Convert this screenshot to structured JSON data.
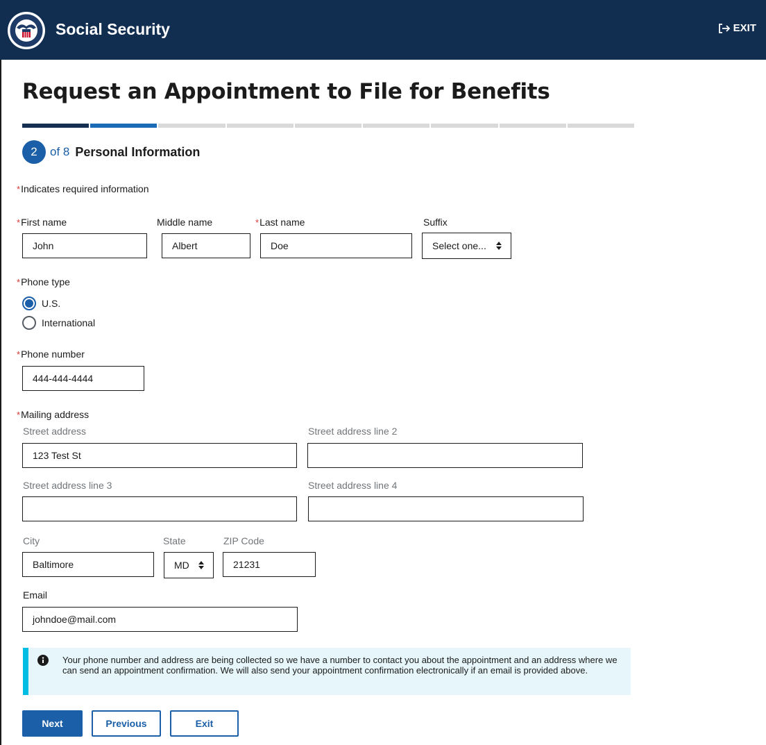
{
  "header": {
    "brand": "Social Security",
    "exit_label": "EXIT"
  },
  "page": {
    "title": "Request an Appointment to File for Benefits"
  },
  "progress": {
    "current_step": 2,
    "total_steps": 8,
    "step_label": "of 8",
    "step_name": "Personal Information"
  },
  "form": {
    "required_note": "Indicates required information",
    "required_marker": "*",
    "first_name": {
      "label": "First name",
      "value": "John"
    },
    "middle_name": {
      "label": "Middle name",
      "value": "Albert"
    },
    "last_name": {
      "label": "Last name",
      "value": "Doe"
    },
    "suffix": {
      "label": "Suffix",
      "selected": "Select one..."
    },
    "phone_type": {
      "label": "Phone type",
      "options": [
        "U.S.",
        "International"
      ],
      "selected": "U.S."
    },
    "phone_number": {
      "label": "Phone number",
      "value": "444-444-4444"
    },
    "mailing_address": {
      "label": "Mailing address",
      "street1": {
        "label": "Street address",
        "value": "123 Test St"
      },
      "street2": {
        "label": "Street address line 2",
        "value": ""
      },
      "street3": {
        "label": "Street address line 3",
        "value": ""
      },
      "street4": {
        "label": "Street address line 4",
        "value": ""
      },
      "city": {
        "label": "City",
        "value": "Baltimore"
      },
      "state": {
        "label": "State",
        "selected": "MD"
      },
      "zip": {
        "label": "ZIP Code",
        "value": "21231"
      }
    },
    "email": {
      "label": "Email",
      "value": "johndoe@mail.com"
    }
  },
  "info": {
    "text": "Your phone number and address are being collected so we have a number to contact you about the appointment and an address where we can send an appointment confirmation. We will also send your appointment confirmation electronically if an email is provided above."
  },
  "buttons": {
    "next": "Next",
    "previous": "Previous",
    "exit": "Exit"
  },
  "colors": {
    "header_bg": "#112e51",
    "primary": "#1a5fa8",
    "required": "#d83933",
    "info_bg": "#e6f6fa",
    "info_accent": "#00bde3"
  },
  "icons": {
    "seal": "ssa-seal-icon",
    "exit": "exit-arrow-icon",
    "info": "info-circle-icon",
    "select": "sort-arrows-icon"
  }
}
